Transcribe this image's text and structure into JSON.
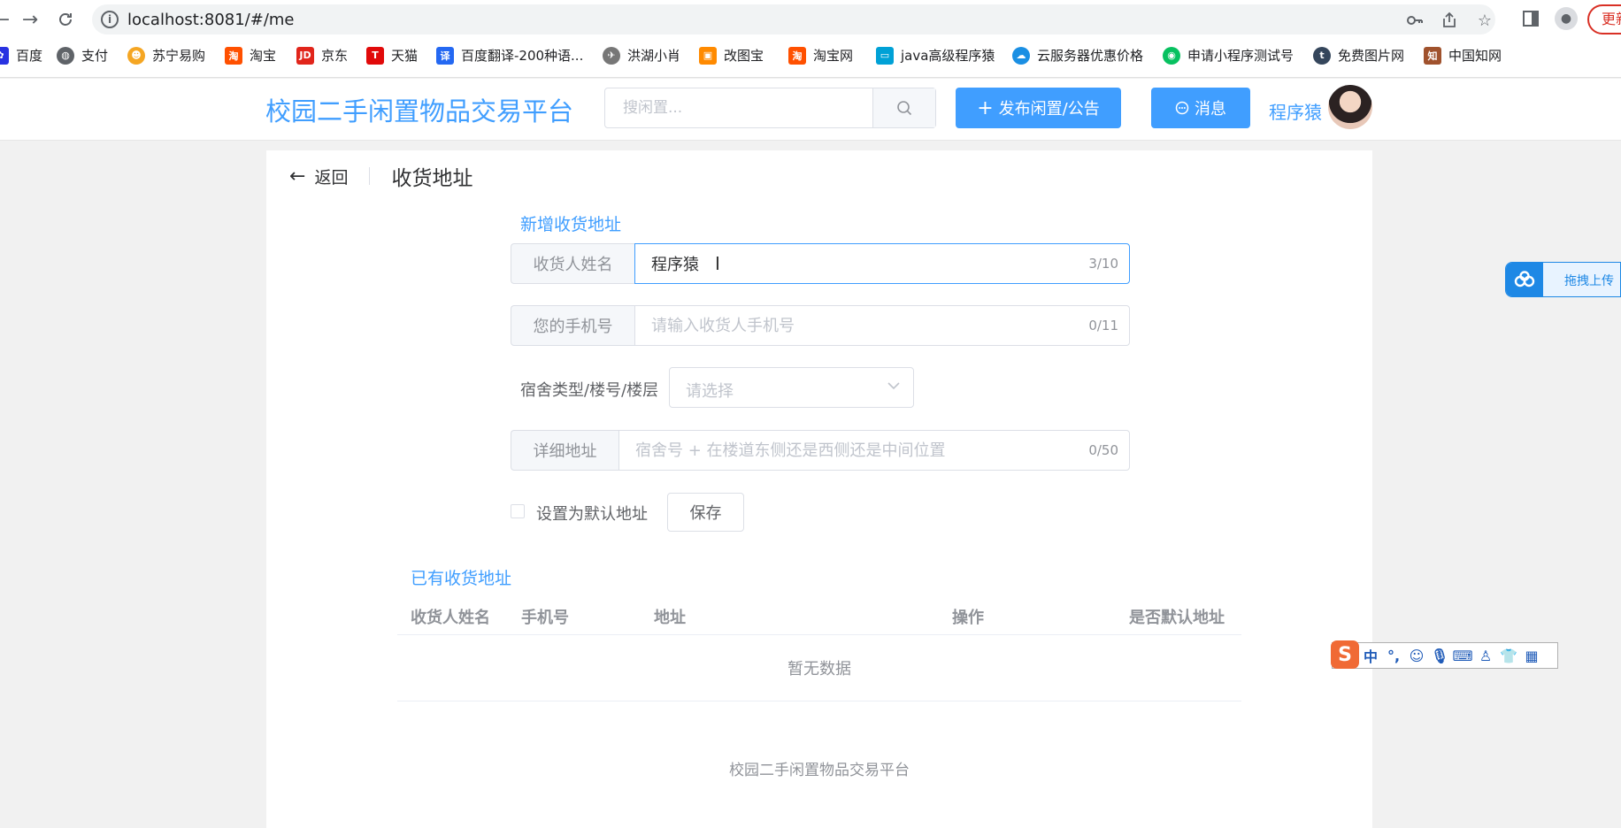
{
  "browser": {
    "url": "localhost:8081/#/me",
    "update_label": "更新",
    "bookmarks": [
      {
        "label": "百度",
        "icon": "paw-icon",
        "color": "#2932e1"
      },
      {
        "label": "支付",
        "icon": "globe-icon",
        "color": "#5f6368"
      },
      {
        "label": "苏宁易购",
        "icon": "lion-icon",
        "color": "#f5a623"
      },
      {
        "label": "淘宝",
        "icon": "taobao-icon",
        "color": "#ff5000"
      },
      {
        "label": "京东",
        "icon": "jd-icon",
        "color": "#e1251b"
      },
      {
        "label": "天猫",
        "icon": "tmall-icon",
        "color": "#e10a0a"
      },
      {
        "label": "百度翻译-200种语...",
        "icon": "translate-icon",
        "color": "#2468f2"
      },
      {
        "label": "洪湖小肖",
        "icon": "wing-icon",
        "color": "#777777"
      },
      {
        "label": "改图宝",
        "icon": "gaitubao-icon",
        "color": "#ff8a00"
      },
      {
        "label": "淘宝网",
        "icon": "taobao-icon",
        "color": "#ff5000"
      },
      {
        "label": "java高级程序猿",
        "icon": "bilibili-icon",
        "color": "#00a1d6"
      },
      {
        "label": "云服务器优惠价格",
        "icon": "cloud-icon",
        "color": "#1a8fe3"
      },
      {
        "label": "申请小程序测试号",
        "icon": "wechat-icon",
        "color": "#07c160"
      },
      {
        "label": "免费图片网",
        "icon": "tumblr-icon",
        "color": "#35465c"
      },
      {
        "label": "中国知网",
        "icon": "cnki-icon",
        "color": "#a0522d"
      }
    ]
  },
  "header": {
    "title": "校园二手闲置物品交易平台",
    "search_placeholder": "搜闲置...",
    "publish_label": "发布闲置/公告",
    "message_label": "消息",
    "user_name": "程序猿"
  },
  "page": {
    "back_label": "返回",
    "title": "收货地址"
  },
  "form": {
    "section_title": "新增收货地址",
    "name_label": "收货人姓名",
    "name_value": "程序猿",
    "name_counter": "3/10",
    "phone_label": "您的手机号",
    "phone_placeholder": "请输入收货人手机号",
    "phone_counter": "0/11",
    "dorm_label": "宿舍类型/楼号/楼层",
    "dorm_placeholder": "请选择",
    "detail_label": "详细地址",
    "detail_placeholder": "宿舍号 + 在楼道东侧还是西侧还是中间位置",
    "detail_counter": "0/50",
    "default_label": "设置为默认地址",
    "save_label": "保存"
  },
  "table": {
    "section_title": "已有收货地址",
    "columns": [
      "收货人姓名",
      "手机号",
      "地址",
      "操作",
      "是否默认地址"
    ],
    "empty_text": "暂无数据"
  },
  "footer": {
    "text": "校园二手闲置物品交易平台"
  },
  "overlays": {
    "upload_label": "拖拽上传",
    "ime_lang": "中",
    "ime_punct": "°,"
  },
  "colors": {
    "primary": "#409eff",
    "ime": "#f06a35"
  }
}
